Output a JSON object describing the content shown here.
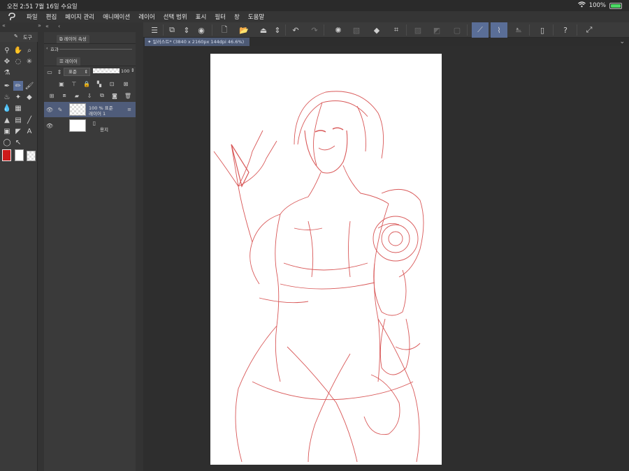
{
  "status": {
    "time": "오전 2:51",
    "date": "7월 16일 수요일",
    "battery": "100%"
  },
  "menu": [
    "파일",
    "편집",
    "페이지 관리",
    "애니메이션",
    "레이어",
    "선택 범위",
    "표시",
    "필터",
    "창",
    "도움말"
  ],
  "tool_panel": {
    "tab_label": "도구"
  },
  "layer_property_panel": {
    "tab_label": "레이어 속성",
    "effect_label": "효과"
  },
  "layer_panel": {
    "tab_label": "레이어",
    "blend_mode": "표준",
    "opacity": "100",
    "layers": [
      {
        "line1": "100 % 표준",
        "line2": "레이어 1",
        "selected": true
      },
      {
        "line1": "",
        "line2": "용지",
        "selected": false
      }
    ]
  },
  "document": {
    "tab_title": "일러스트* (3840 x 2160px 144dpi 46.6%)"
  },
  "colors": {
    "accent": "#5a6e97",
    "main_color": "#cc1a1a",
    "sub_color": "#ffffff",
    "sketch_line": "#d23a3a"
  }
}
